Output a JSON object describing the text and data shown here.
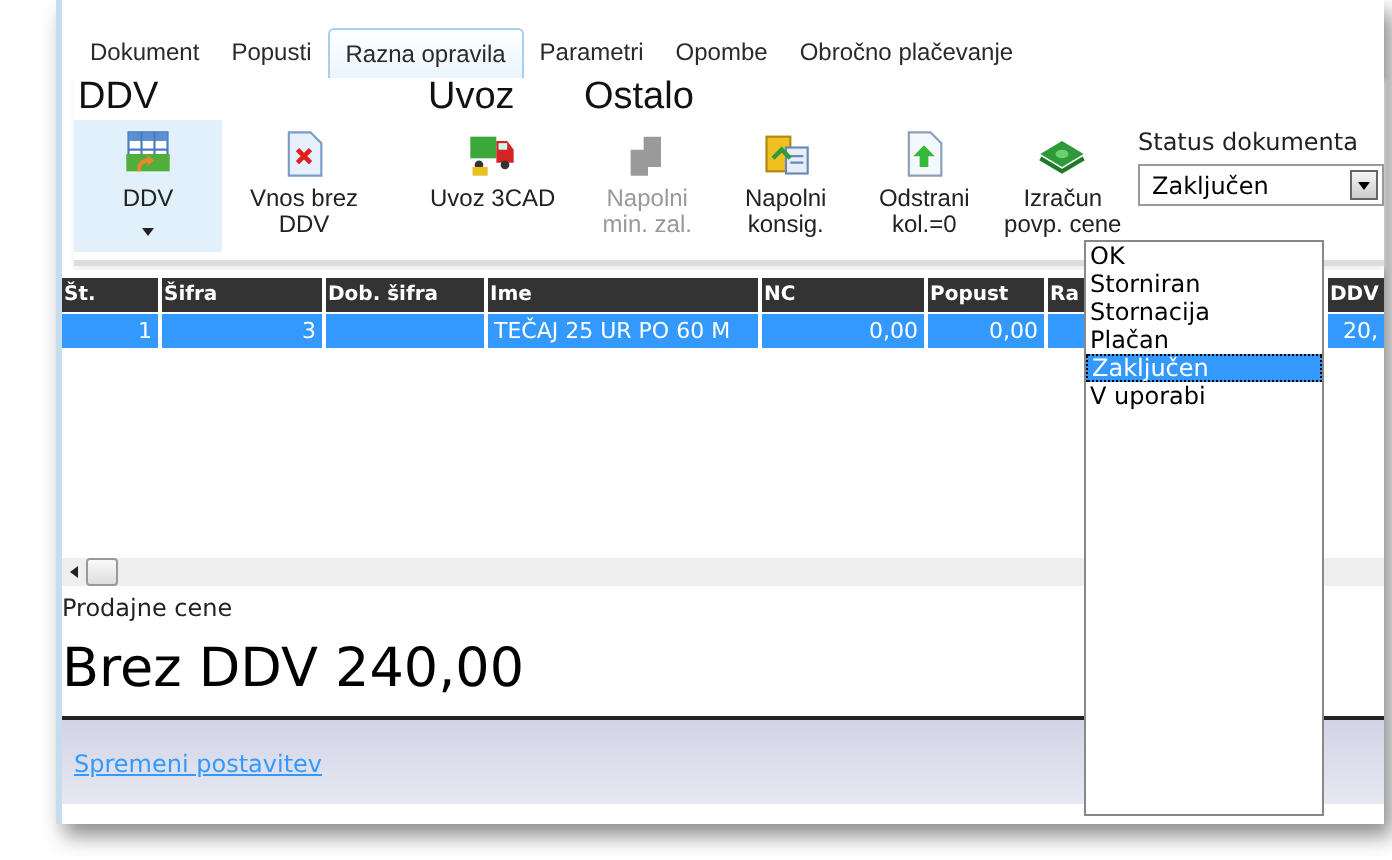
{
  "tabs": [
    {
      "label": "Dokument",
      "selected": false
    },
    {
      "label": "Popusti",
      "selected": false
    },
    {
      "label": "Razna opravila",
      "selected": true
    },
    {
      "label": "Parametri",
      "selected": false
    },
    {
      "label": "Opombe",
      "selected": false
    },
    {
      "label": "Obročno plačevanje",
      "selected": false
    }
  ],
  "ribbon": {
    "groups": [
      {
        "label": "DDV",
        "buttons": [
          {
            "label": "DDV",
            "selected": true,
            "disabled": false
          },
          {
            "label": "Vnos brez DDV",
            "selected": false,
            "disabled": false
          }
        ]
      },
      {
        "label": "Uvoz",
        "buttons": [
          {
            "label": "Uvoz 3CAD",
            "selected": false,
            "disabled": false
          }
        ]
      },
      {
        "label": "Ostalo",
        "buttons": [
          {
            "label": "Napolni min. zal.",
            "selected": false,
            "disabled": true
          },
          {
            "label": "Napolni konsig.",
            "selected": false,
            "disabled": false
          },
          {
            "label": "Odstrani kol.=0",
            "selected": false,
            "disabled": false
          },
          {
            "label": "Izračun povp. cene",
            "selected": false,
            "disabled": false
          }
        ]
      }
    ]
  },
  "status": {
    "label": "Status dokumenta",
    "value": "Zaključen",
    "expanded": true,
    "options": [
      {
        "label": "OK",
        "selected": false
      },
      {
        "label": "Storniran",
        "selected": false
      },
      {
        "label": "Stornacija",
        "selected": false
      },
      {
        "label": "Plačan",
        "selected": false
      },
      {
        "label": "Zaključen",
        "selected": true
      },
      {
        "label": "V uporabi",
        "selected": false
      }
    ]
  },
  "table": {
    "columns": [
      "Št.",
      "Šifra",
      "Dob. šifra",
      "Ime",
      "NC",
      "Popust",
      "Ra",
      "DDV"
    ],
    "rows": [
      {
        "selected": true,
        "cells": [
          "1",
          "3",
          null,
          "TEČAJ 25 UR PO 60 M",
          "0,00",
          "0,00",
          null,
          "20,"
        ]
      }
    ]
  },
  "prices": {
    "label": "Prodajne cene",
    "total": "Brez DDV 240,00"
  },
  "footer": {
    "link": "Spremeni postavitev"
  }
}
